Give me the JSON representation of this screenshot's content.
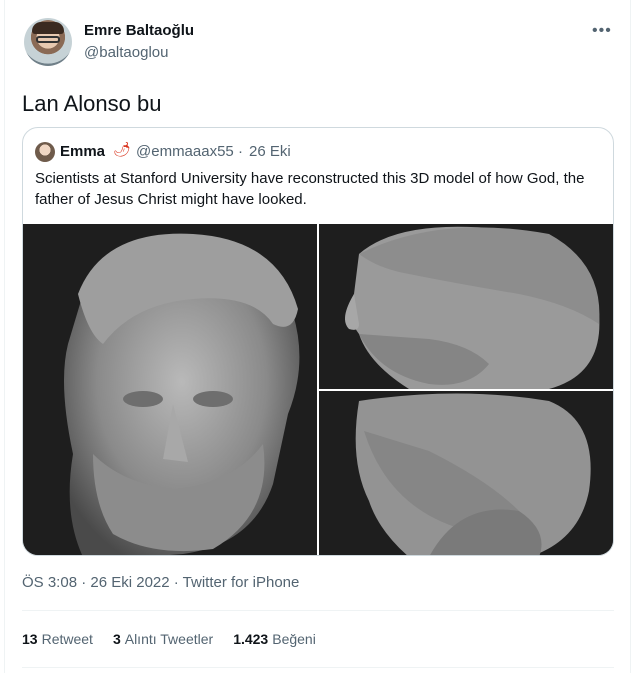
{
  "author": {
    "name": "Emre Baltaoğlu",
    "handle": "@baltaoglou",
    "more_icon": "more-icon"
  },
  "tweet": {
    "text": "Lan Alonso bu"
  },
  "quoted": {
    "name": "Emma",
    "emoji": "🌶",
    "handle": "@emmaaax55",
    "separator": "·",
    "date": "26 Eki",
    "text": "Scientists at Stanford University have reconstructed this 3D model of how God, the father of Jesus Christ might have looked."
  },
  "meta": {
    "time": "ÖS 3:08",
    "date": "26 Eki 2022",
    "source": "Twitter for iPhone",
    "full": "ÖS 3:08 · 26 Eki 2022 · Twitter for iPhone"
  },
  "stats": {
    "retweets_count": "13",
    "retweets_label": "Retweet",
    "quotes_count": "3",
    "quotes_label": "Alıntı Tweetler",
    "likes_count": "1.423",
    "likes_label": "Beğeni"
  }
}
